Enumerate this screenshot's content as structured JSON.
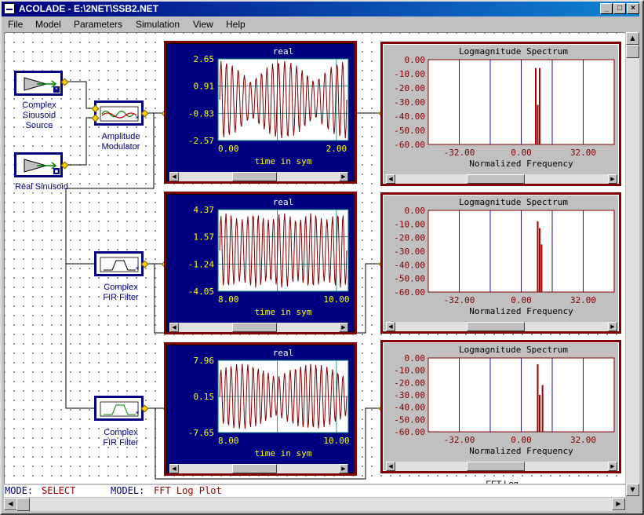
{
  "window": {
    "title": "ACOLADE - E:\\2NET\\SSB2.NET"
  },
  "menu": [
    "File",
    "Model",
    "Parameters",
    "Simulation",
    "View",
    "Help"
  ],
  "blocks": {
    "complex_source": "Complex Sinusoid Source",
    "complex_source_lines": [
      "Complex",
      "Sinusoid",
      "Source"
    ],
    "real_sinusoid": "Real Sinusoid",
    "modulator_lines": [
      "Amplitude",
      "Modulator"
    ],
    "fir1_lines": [
      "Complex",
      "FIR Filter"
    ],
    "fir2_lines": [
      "Complex",
      "FIR Filter"
    ],
    "hidden_label": "FFT Log"
  },
  "status": {
    "mode_label": "MODE:",
    "mode_value": "SELECT",
    "model_label": "MODEL:",
    "model_value": "FFT Log Plot"
  },
  "colors": {
    "time_bg": "#000080",
    "plot_trace": "#800000",
    "spec_bg": "#c0c0c0",
    "spec_trace": "#a00000",
    "axis_text": "#ffff00"
  },
  "chart_data": [
    {
      "type": "line",
      "title": "real",
      "xlabel": "time in sym",
      "ylim": [
        -2.57,
        2.65
      ],
      "yticks": [
        "2.65",
        "0.91",
        "-0.83",
        "-2.57"
      ],
      "xticks": [
        "0.00",
        "2.00"
      ],
      "xlim": [
        0,
        2.2
      ],
      "series": [
        {
          "envelope": "am",
          "cycles": 22,
          "samples": 180
        }
      ]
    },
    {
      "type": "line",
      "title": "real",
      "xlabel": "time in sym",
      "ylim": [
        -4.05,
        4.37
      ],
      "yticks": [
        "4.37",
        "1.57",
        "-1.24",
        "-4.05"
      ],
      "xticks": [
        "8.00",
        "10.00"
      ],
      "xlim": [
        8,
        10.2
      ],
      "series": [
        {
          "envelope": "flat",
          "cycles": 24,
          "samples": 180
        }
      ]
    },
    {
      "type": "line",
      "title": "real",
      "xlabel": "time in sym",
      "ylim": [
        -7.65,
        7.96
      ],
      "yticks": [
        "7.96",
        "0.15",
        "-7.65"
      ],
      "xticks": [
        "8.00",
        "10.00"
      ],
      "xlim": [
        8,
        10.2
      ],
      "series": [
        {
          "envelope": "ssb",
          "cycles": 24,
          "samples": 180
        }
      ]
    },
    {
      "type": "bar",
      "title": "Logmagnitude Spectrum",
      "xlabel": "Normalized Frequency",
      "ylim": [
        -60,
        0
      ],
      "yticks": [
        "0.00",
        "-10.00",
        "-20.00",
        "-30.00",
        "-40.00",
        "-50.00",
        "-60.00"
      ],
      "xticks": [
        "-32.00",
        "0.00",
        "32.00"
      ],
      "xlim": [
        -48,
        48
      ],
      "x": [
        7.5,
        8.5,
        9.5
      ],
      "values": [
        -6,
        -32,
        -6
      ]
    },
    {
      "type": "bar",
      "title": "Logmagnitude Spectrum",
      "xlabel": "Normalized Frequency",
      "ylim": [
        -60,
        0
      ],
      "yticks": [
        "0.00",
        "-10.00",
        "-20.00",
        "-30.00",
        "-40.00",
        "-50.00",
        "-60.00"
      ],
      "xticks": [
        "-32.00",
        "0.00",
        "32.00"
      ],
      "xlim": [
        -48,
        48
      ],
      "x": [
        8.5,
        9.5,
        10.5
      ],
      "values": [
        -8,
        -13,
        -25
      ]
    },
    {
      "type": "bar",
      "title": "Logmagnitude Spectrum",
      "xlabel": "Normalized Frequency",
      "ylim": [
        -60,
        0
      ],
      "yticks": [
        "0.00",
        "-10.00",
        "-20.00",
        "-30.00",
        "-40.00",
        "-50.00",
        "-60.00"
      ],
      "xticks": [
        "-32.00",
        "0.00",
        "32.00"
      ],
      "xlim": [
        -48,
        48
      ],
      "x": [
        8.5,
        9.5,
        11.0
      ],
      "values": [
        -5,
        -30,
        -22
      ]
    }
  ]
}
